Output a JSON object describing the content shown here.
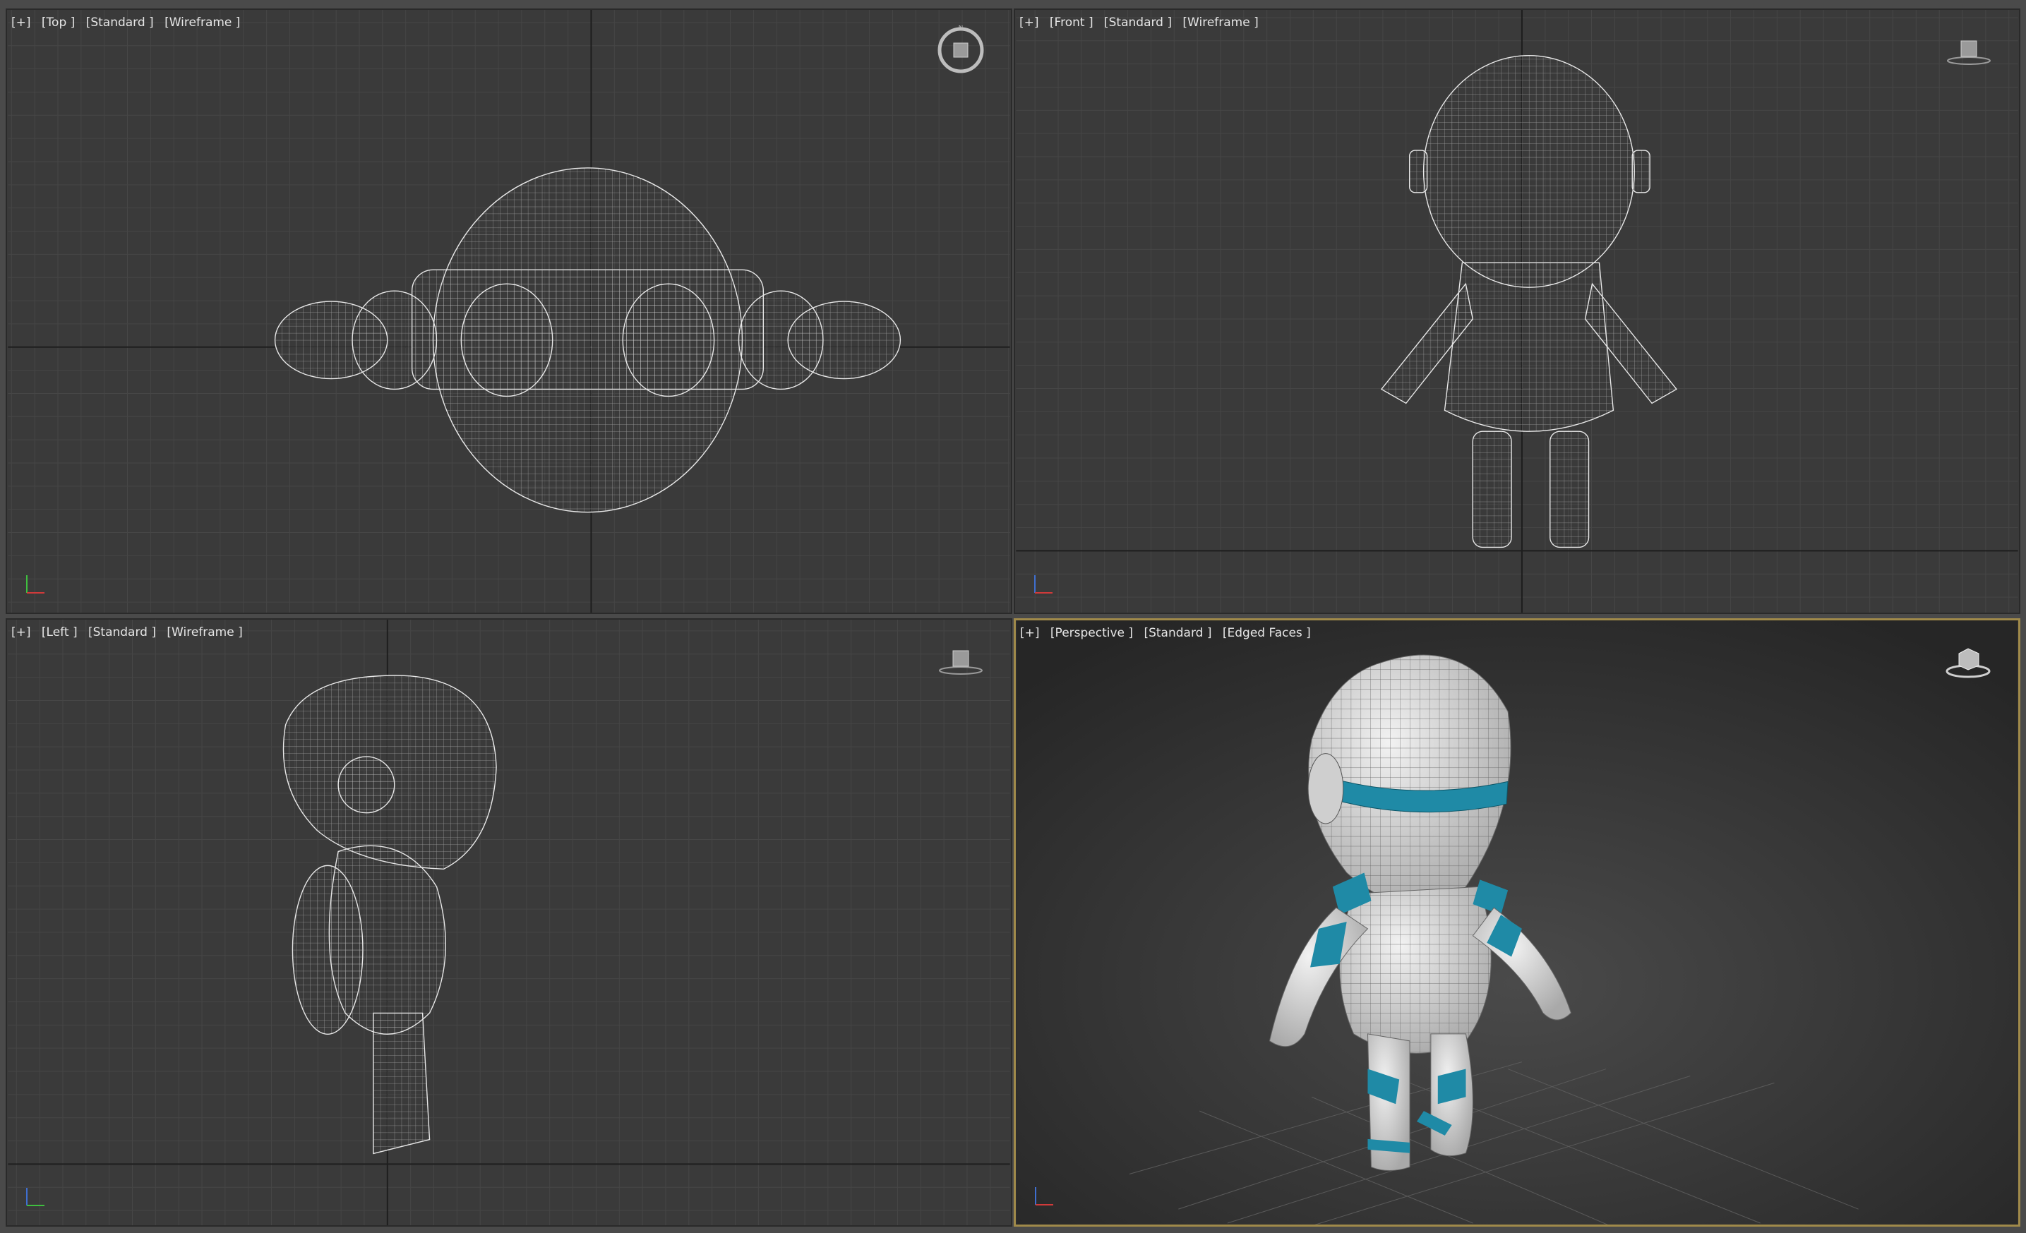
{
  "viewports": {
    "top": {
      "plus": "[+]",
      "view": "[Top ]",
      "shading": "[Standard ]",
      "mode": "[Wireframe ]"
    },
    "front": {
      "plus": "[+]",
      "view": "[Front ]",
      "shading": "[Standard ]",
      "mode": "[Wireframe ]"
    },
    "left": {
      "plus": "[+]",
      "view": "[Left ]",
      "shading": "[Standard ]",
      "mode": "[Wireframe ]"
    },
    "persp": {
      "plus": "[+]",
      "view": "[Perspective ]",
      "shading": "[Standard ]",
      "mode": "[Edged Faces ]"
    }
  },
  "colors": {
    "viewport_bg": "#3a3a3a",
    "grid_minor": "#464646",
    "grid_major": "#1e1e1e",
    "wire": "#e8e8e8",
    "accent_teal": "#1f8aa6",
    "active_border": "#a08a4a"
  },
  "icons": {
    "viewcube": "viewcube-icon",
    "compass": "compass-icon",
    "axis": "axis-tripod-icon"
  }
}
